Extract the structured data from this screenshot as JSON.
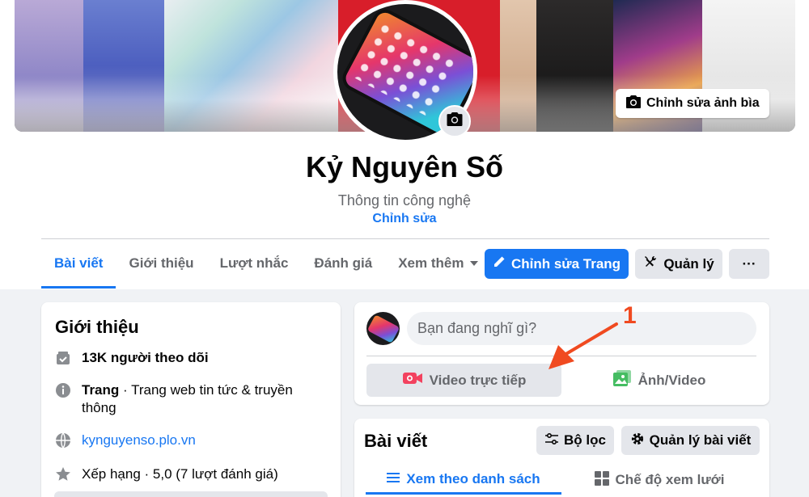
{
  "page": {
    "name": "Kỷ Nguyên Số",
    "description": "Thông tin công nghệ",
    "edit_link": "Chỉnh sửa",
    "edit_cover_label": "Chỉnh sửa ảnh bìa"
  },
  "tabs": [
    {
      "label": "Bài viết",
      "active": true
    },
    {
      "label": "Giới thiệu",
      "active": false
    },
    {
      "label": "Lượt nhắc",
      "active": false
    },
    {
      "label": "Đánh giá",
      "active": false
    },
    {
      "label": "Xem thêm",
      "active": false
    }
  ],
  "actions": {
    "edit_page": "Chỉnh sửa Trang",
    "manage": "Quản lý",
    "more": "···"
  },
  "intro": {
    "title": "Giới thiệu",
    "followers": "13K người theo dõi",
    "category_bold": "Trang",
    "category_rest": " · Trang web tin tức & truyền thông",
    "website": "kynguyenso.plo.vn",
    "rating": "Xếp hạng · 5,0 (7 lượt đánh giá)"
  },
  "composer": {
    "placeholder": "Bạn đang nghĩ gì?",
    "live_video": "Video trực tiếp",
    "photo_video": "Ảnh/Video"
  },
  "annotation": {
    "number": "1",
    "color": "#f04a20"
  },
  "posts": {
    "title": "Bài viết",
    "filter": "Bộ lọc",
    "manage_posts": "Quản lý bài viết",
    "list_view": "Xem theo danh sách",
    "grid_view": "Chế độ xem lưới"
  },
  "colors": {
    "accent": "#1877f2",
    "live_red": "#f3425f",
    "photo_green": "#45bd62"
  },
  "icons": [
    "camera-icon",
    "pencil-icon",
    "tools-icon",
    "more-icon",
    "followers-icon",
    "info-icon",
    "globe-icon",
    "star-icon",
    "live-video-icon",
    "photo-icon",
    "filter-icon",
    "gear-icon",
    "list-icon",
    "grid-icon",
    "arrow-icon"
  ]
}
